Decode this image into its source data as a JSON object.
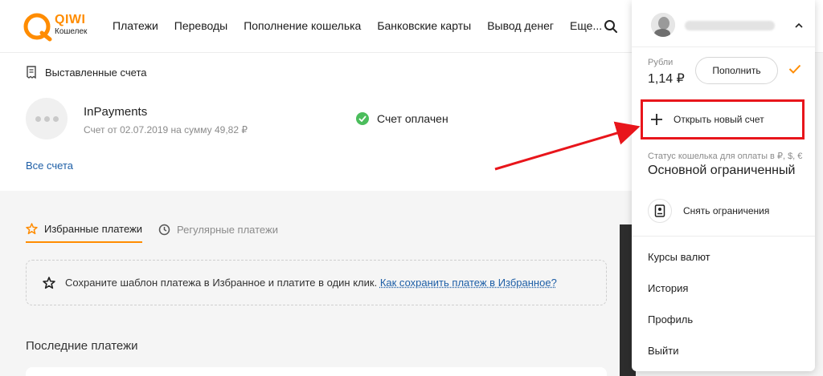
{
  "header": {
    "logo_text": "QIWI",
    "logo_sub": "Кошелек",
    "nav": [
      "Платежи",
      "Переводы",
      "Пополнение кошелька",
      "Банковские карты",
      "Вывод денег",
      "Еще..."
    ]
  },
  "invoices": {
    "title": "Выставленные счета",
    "item": {
      "name": "InPayments",
      "description": "Счет от 02.07.2019 на сумму 49,82 ₽",
      "status": "Счет оплачен"
    },
    "all_link": "Все счета"
  },
  "tabs": [
    {
      "label": "Избранные платежи",
      "active": true
    },
    {
      "label": "Регулярные платежи",
      "active": false
    }
  ],
  "favorites_hint": {
    "text": "Сохраните шаблон платежа в Избранное и платите в один клик.",
    "link": "Как сохранить платеж в Избранное?"
  },
  "recent_title": "Последние платежи",
  "panel": {
    "currency_label": "Рубли",
    "balance": "1,14 ₽",
    "topup_label": "Пополнить",
    "new_account_label": "Открыть новый счет",
    "status_label": "Статус кошелька для оплаты в ₽, $, €",
    "status_value": "Основной ограниченный",
    "remove_limits_label": "Снять ограничения",
    "menu": [
      "Курсы валют",
      "История",
      "Профиль",
      "Выйти"
    ]
  },
  "colors": {
    "accent": "#ff8c00",
    "link": "#1d5ea6",
    "highlight": "#e8151b",
    "success": "#4bbd5c"
  }
}
